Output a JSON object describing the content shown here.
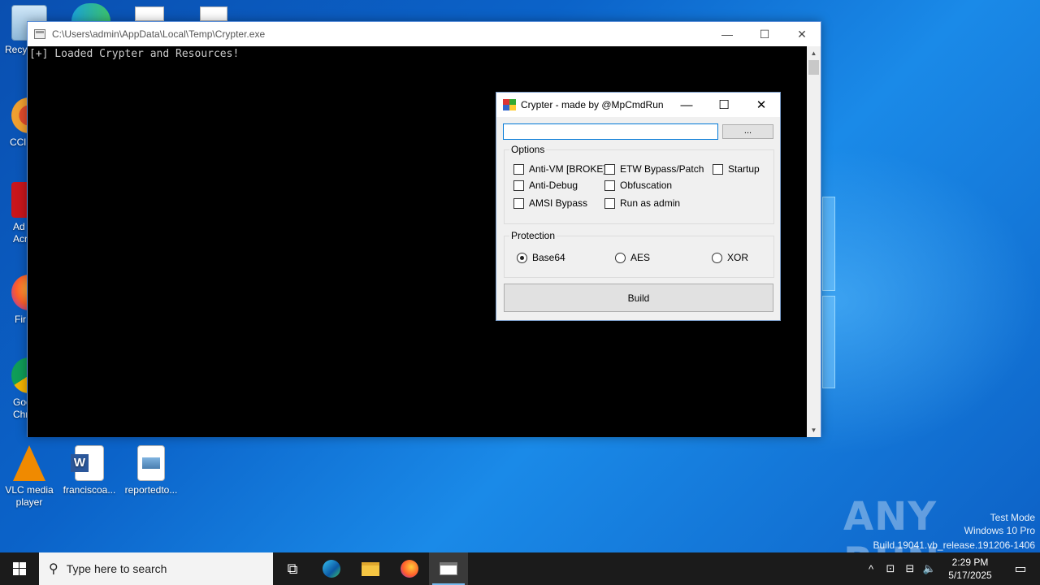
{
  "desktop": {
    "icons": [
      {
        "label": "Recy",
        "name": "recycle-bin"
      },
      {
        "label": "CCl",
        "name": "ccleaner"
      },
      {
        "label": "Ad Acr",
        "name": "adobe-acrobat"
      },
      {
        "label": "Fir",
        "name": "firefox"
      },
      {
        "label": "Goo Chr",
        "name": "google-chrome"
      },
      {
        "label": "VLC media player",
        "name": "vlc"
      },
      {
        "label": "franciscoa...",
        "name": "word-doc"
      },
      {
        "label": "reportedto...",
        "name": "image-file"
      }
    ]
  },
  "console": {
    "title": "C:\\Users\\admin\\AppData\\Local\\Temp\\Crypter.exe",
    "output": "[+] Loaded Crypter and Resources!",
    "minimize": "—",
    "maximize": "☐",
    "close": "✕"
  },
  "dialog": {
    "title": "Crypter - made by @MpCmdRun",
    "minimize": "—",
    "maximize": "☐",
    "close": "✕",
    "file_path": "",
    "browse_label": "...",
    "options": {
      "legend": "Options",
      "items": [
        {
          "label": "Anti-VM [BROKE]",
          "checked": false
        },
        {
          "label": "ETW Bypass/Patch",
          "checked": false
        },
        {
          "label": "Startup",
          "checked": false
        },
        {
          "label": "Anti-Debug",
          "checked": false
        },
        {
          "label": "Obfuscation",
          "checked": false
        },
        {
          "label": "AMSI Bypass",
          "checked": false
        },
        {
          "label": "Run as admin",
          "checked": false
        }
      ]
    },
    "protection": {
      "legend": "Protection",
      "items": [
        {
          "label": "Base64",
          "selected": true
        },
        {
          "label": "AES",
          "selected": false
        },
        {
          "label": "XOR",
          "selected": false
        }
      ]
    },
    "build_label": "Build"
  },
  "watermark": {
    "brand": "ANY RUN",
    "line1": "Test Mode",
    "line2": "Windows 10 Pro",
    "line3": "Build 19041.vb_release.191206-1406"
  },
  "taskbar": {
    "search_placeholder": "Type here to search",
    "time": "2:29 PM",
    "date": "5/17/2025"
  }
}
